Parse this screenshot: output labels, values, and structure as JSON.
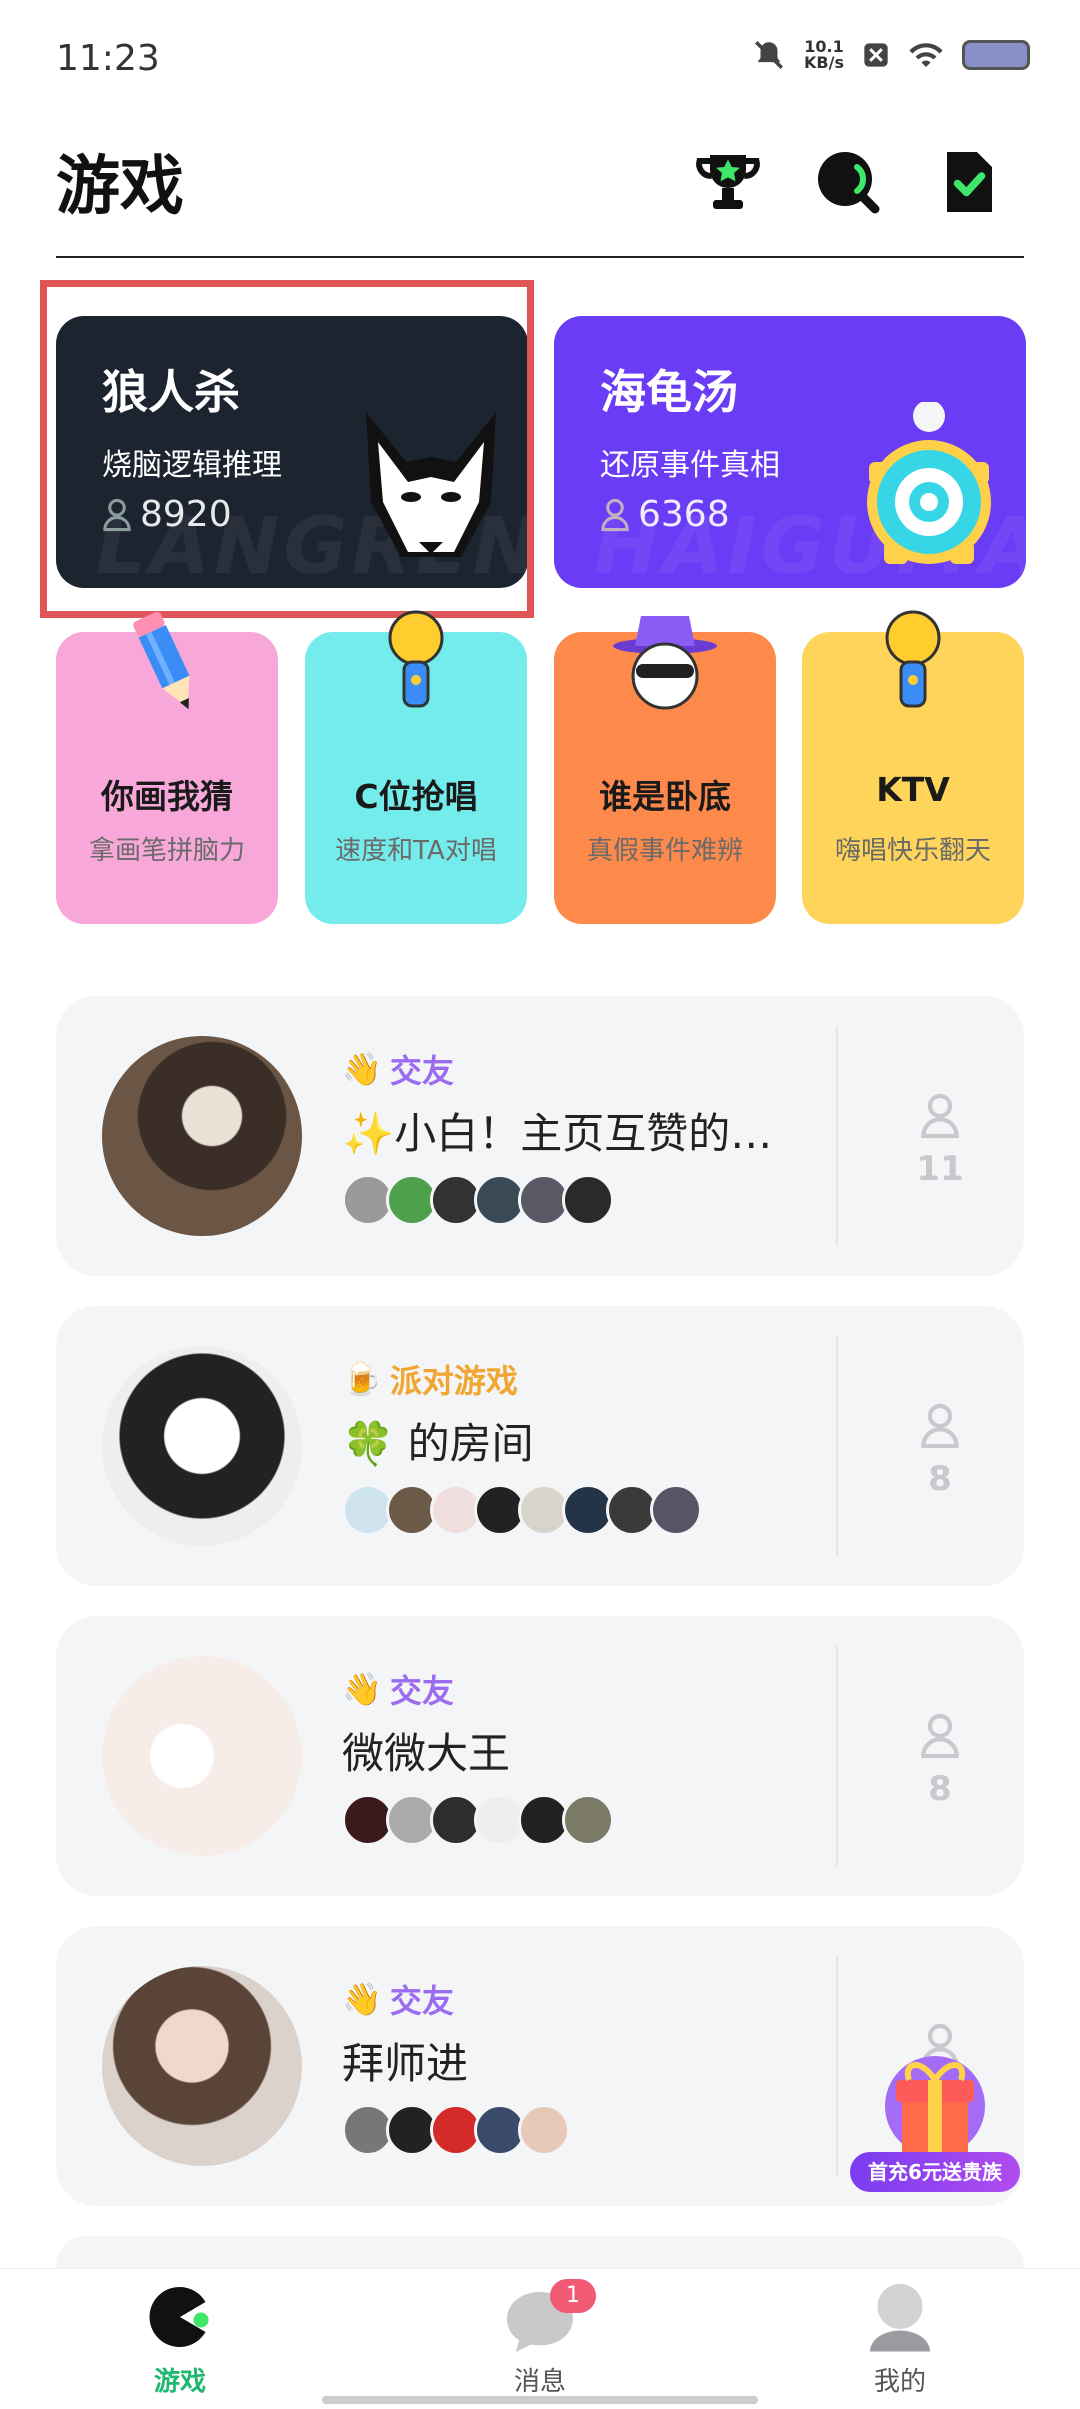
{
  "status_bar": {
    "time": "11:23",
    "net_speed": "10.1",
    "net_unit": "KB/s"
  },
  "header": {
    "title": "游戏"
  },
  "featured": [
    {
      "name": "狼人杀",
      "subtitle": "烧脑逻辑推理",
      "count": "8920",
      "watermark": "LANGRENSHA",
      "color": "#1c2430"
    },
    {
      "name": "海龟汤",
      "subtitle": "还原事件真相",
      "count": "6368",
      "watermark": "HAIGUITANG",
      "color": "#6b3cf5"
    }
  ],
  "games": [
    {
      "name": "你画我猜",
      "subtitle": "拿画笔拼脑力",
      "color": "#f7a8d8"
    },
    {
      "name": "C位抢唱",
      "subtitle": "速度和TA对唱",
      "color": "#75ecec"
    },
    {
      "name": "谁是卧底",
      "subtitle": "真假事件难辨",
      "color": "#fd8a4a"
    },
    {
      "name": "KTV",
      "subtitle": "嗨唱快乐翻天",
      "color": "#ffd45a"
    }
  ],
  "rooms": [
    {
      "tag": "交友",
      "tag_color": "#9b6cf0",
      "name": "✨小白！主页互赞的…",
      "count": "11"
    },
    {
      "tag": "派对游戏",
      "tag_color": "#f0a630",
      "name": "🍀 的房间",
      "count": "8"
    },
    {
      "tag": "交友",
      "tag_color": "#9b6cf0",
      "name": "微微大王",
      "count": "8"
    },
    {
      "tag": "交友",
      "tag_color": "#9b6cf0",
      "name": "拜师进",
      "count": ""
    }
  ],
  "promo": {
    "label": "首充6元送贵族"
  },
  "nav": {
    "items": [
      {
        "label": "游戏",
        "active": true
      },
      {
        "label": "消息",
        "active": false
      },
      {
        "label": "我的",
        "active": false
      }
    ],
    "message_badge": "1"
  }
}
